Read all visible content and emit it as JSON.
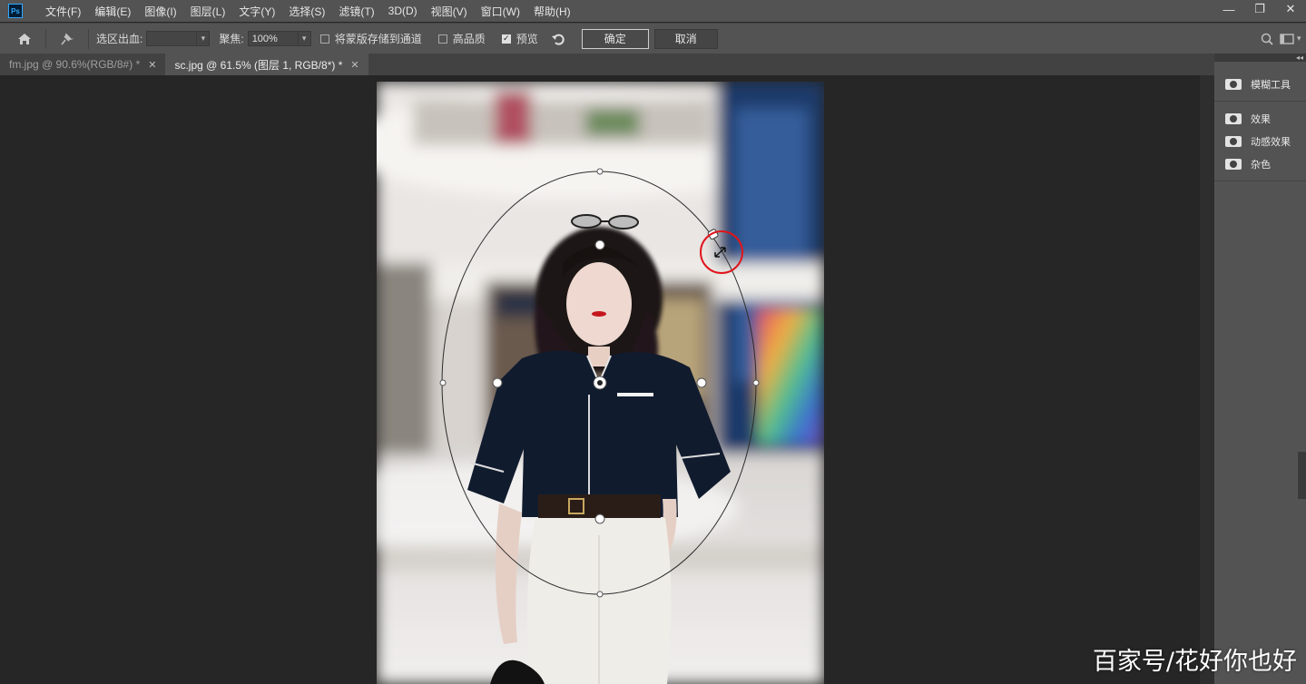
{
  "app": {
    "logo": "Ps"
  },
  "menu": [
    "文件(F)",
    "编辑(E)",
    "图像(I)",
    "图层(L)",
    "文字(Y)",
    "选择(S)",
    "滤镜(T)",
    "3D(D)",
    "视图(V)",
    "窗口(W)",
    "帮助(H)"
  ],
  "window_controls": {
    "minimize": "—",
    "restore": "❐",
    "close": "✕"
  },
  "options": {
    "feather_label": "选区出血:",
    "feather_value": "",
    "focus_label": "聚焦:",
    "focus_value": "100%",
    "save_mask_label": "将蒙版存储到通道",
    "save_mask_checked": false,
    "high_quality_label": "高品质",
    "high_quality_checked": false,
    "preview_label": "预览",
    "preview_checked": true,
    "ok_label": "确定",
    "cancel_label": "取消"
  },
  "tabs": [
    {
      "label": "fm.jpg @ 90.6%(RGB/8#) *",
      "active": false
    },
    {
      "label": "sc.jpg @ 61.5% (图层 1, RGB/8*) *",
      "active": true
    }
  ],
  "panel": {
    "top_arrows": "◂◂",
    "items": [
      {
        "label": "模糊工具",
        "icon": "blur-tools-icon"
      },
      {
        "label": "效果",
        "icon": "effects-icon"
      },
      {
        "label": "动感效果",
        "icon": "motion-effects-icon"
      },
      {
        "label": "杂色",
        "icon": "noise-icon"
      }
    ]
  },
  "watermark": "百家号/花好你也好",
  "accent": {
    "highlight_circle": "#e0151c",
    "tab_active_bg": "#535353",
    "ui_bg": "#535353"
  }
}
